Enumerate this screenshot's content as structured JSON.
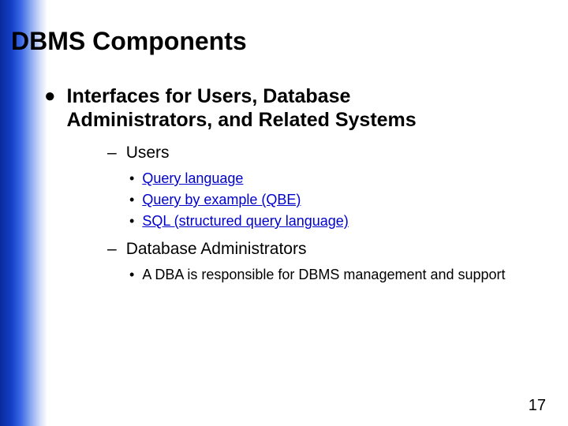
{
  "title": "DBMS Components",
  "main_bullet": "Interfaces for Users, Database Administrators, and Related Systems",
  "sections": [
    {
      "heading": "Users",
      "items": [
        {
          "text": "Query language",
          "link": true
        },
        {
          "text": "Query by example (QBE)",
          "link": true
        },
        {
          "text": "SQL (structured query language)",
          "link": true
        }
      ]
    },
    {
      "heading": "Database Administrators",
      "items": [
        {
          "text": "A DBA is responsible for DBMS management and support",
          "link": false
        }
      ]
    }
  ],
  "page_number": "17"
}
